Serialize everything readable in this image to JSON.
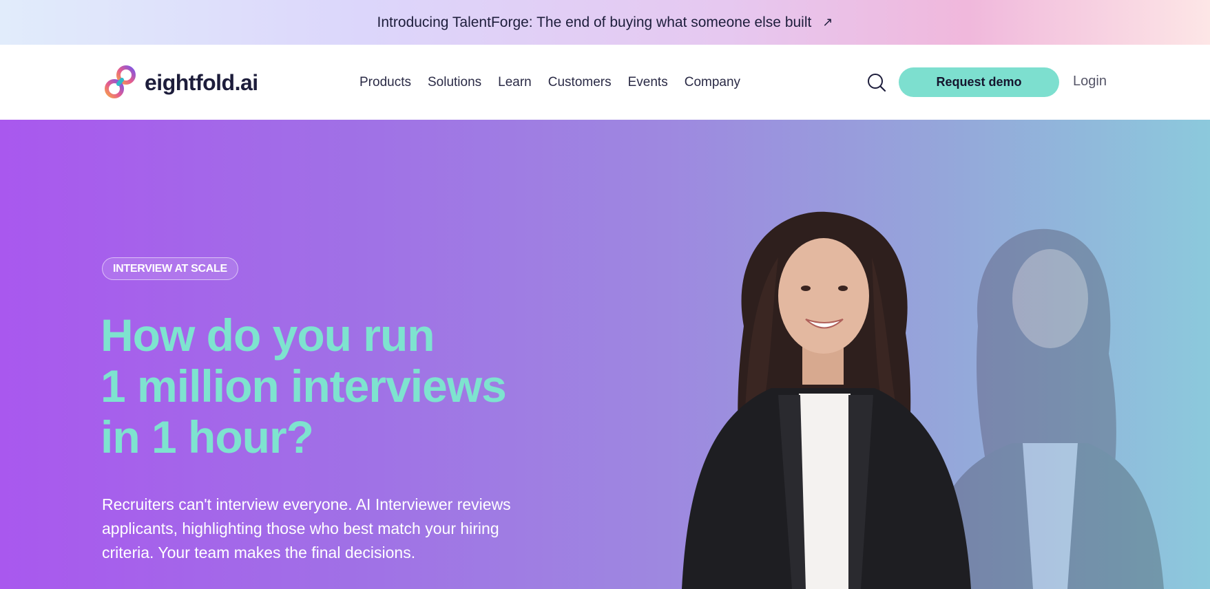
{
  "announcement": {
    "text": "Introducing TalentForge: The end of buying what someone else built",
    "arrow_icon": "arrow-up-right-icon"
  },
  "header": {
    "logo_text": "eightfold.ai",
    "nav": [
      "Products",
      "Solutions",
      "Learn",
      "Customers",
      "Events",
      "Company"
    ],
    "search_icon": "search-icon",
    "cta_label": "Request demo",
    "login_label": "Login"
  },
  "hero": {
    "badge": "INTERVIEW AT SCALE",
    "title_lines": [
      "How do you run",
      "1 million interviews",
      "in 1 hour?"
    ],
    "description": "Recruiters can't interview everyone. AI Interviewer reviews applicants, highlighting those who best match your hiring criteria. Your team makes the final decisions."
  },
  "colors": {
    "accent": "#7ddfcf",
    "headline": "#7ee3cf",
    "hero_gradient_start": "#a958ee",
    "hero_gradient_end": "#8cc9dc",
    "text_dark": "#1d1d3b"
  }
}
